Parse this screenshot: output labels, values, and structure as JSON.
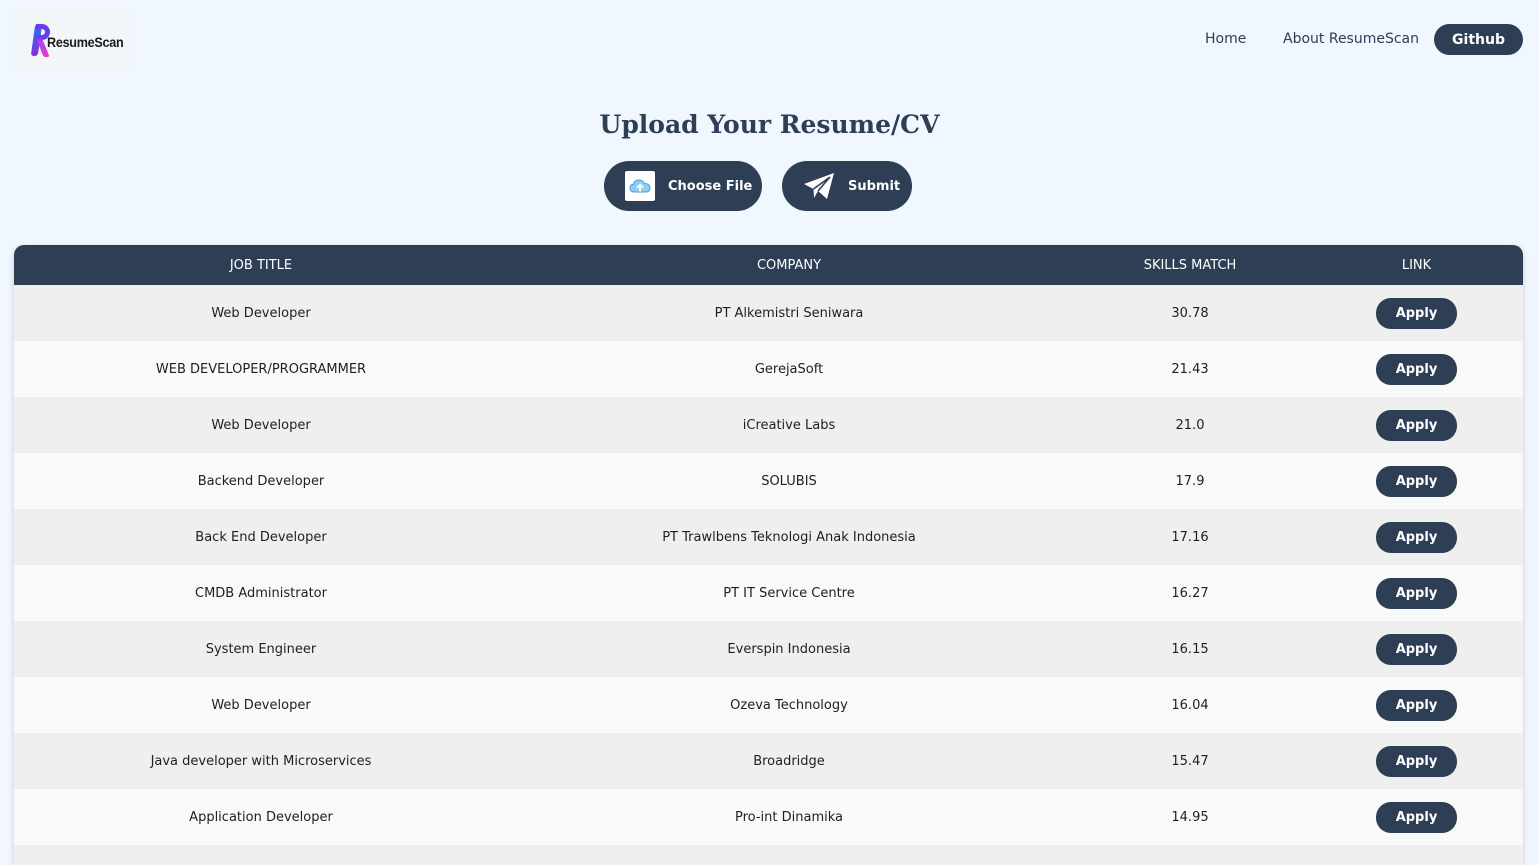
{
  "brand": {
    "name": "ResumeScan"
  },
  "nav": {
    "home": "Home",
    "about": "About ResumeScan",
    "github": "Github"
  },
  "upload": {
    "title": "Upload Your Resume/CV",
    "choose_label": "Choose File",
    "submit_label": "Submit"
  },
  "colors": {
    "background": "#f0f7fe",
    "primary": "#2d3e55",
    "row_alt": "#efefef",
    "row": "#f9f9f9"
  },
  "table": {
    "headers": [
      "JOB TITLE",
      "COMPANY",
      "SKILLS MATCH",
      "LINK"
    ],
    "rows": [
      {
        "title": "Web Developer",
        "company": "PT Alkemistri Seniwara",
        "match": "30.78",
        "link": "Apply"
      },
      {
        "title": "WEB DEVELOPER/PROGRAMMER",
        "company": "GerejaSoft",
        "match": "21.43",
        "link": "Apply"
      },
      {
        "title": "Web Developer",
        "company": "iCreative Labs",
        "match": "21.0",
        "link": "Apply"
      },
      {
        "title": "Backend Developer",
        "company": "SOLUBIS",
        "match": "17.9",
        "link": "Apply"
      },
      {
        "title": "Back End Developer",
        "company": "PT Trawlbens Teknologi Anak Indonesia",
        "match": "17.16",
        "link": "Apply"
      },
      {
        "title": "CMDB Administrator",
        "company": "PT IT Service Centre",
        "match": "16.27",
        "link": "Apply"
      },
      {
        "title": "System Engineer",
        "company": "Everspin Indonesia",
        "match": "16.15",
        "link": "Apply"
      },
      {
        "title": "Web Developer",
        "company": "Ozeva Technology",
        "match": "16.04",
        "link": "Apply"
      },
      {
        "title": "Java developer with Microservices",
        "company": "Broadridge",
        "match": "15.47",
        "link": "Apply"
      },
      {
        "title": "Application Developer",
        "company": "Pro-int Dinamika",
        "match": "14.95",
        "link": "Apply"
      }
    ]
  }
}
